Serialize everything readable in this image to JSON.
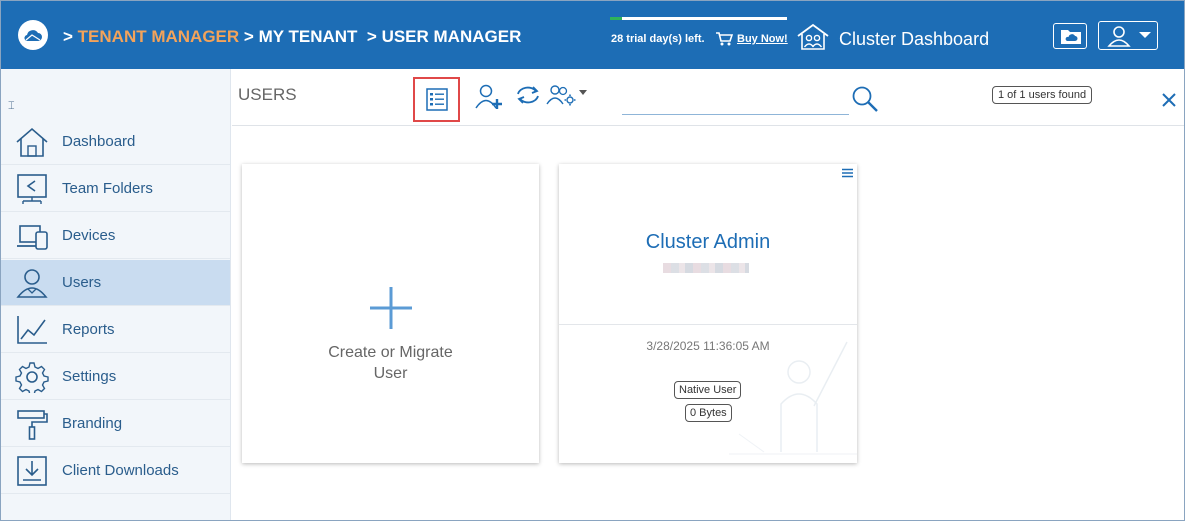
{
  "header": {
    "breadcrumb": {
      "sep1": ">",
      "tenant_manager": "TENANT MANAGER",
      "sep2": ">",
      "my_tenant": "MY TENANT",
      "sep3": ">",
      "user_manager": "USER MANAGER"
    },
    "trial_text": "28 trial day(s) left.",
    "trial_progress_fraction": 0.07,
    "buy_now": "Buy Now!",
    "cluster_dashboard": "Cluster Dashboard",
    "icons": [
      "cloud-logo-icon",
      "cart-icon",
      "home-users-icon",
      "folder-cloud-icon",
      "user-icon",
      "caret-down-icon"
    ]
  },
  "sidebar": {
    "items": [
      {
        "label": "Dashboard",
        "icon": "home-icon",
        "active": false
      },
      {
        "label": "Team Folders",
        "icon": "shared-folder-icon",
        "active": false
      },
      {
        "label": "Devices",
        "icon": "devices-icon",
        "active": false
      },
      {
        "label": "Users",
        "icon": "users-icon",
        "active": true
      },
      {
        "label": "Reports",
        "icon": "reports-icon",
        "active": false
      },
      {
        "label": "Settings",
        "icon": "gear-icon",
        "active": false
      },
      {
        "label": "Branding",
        "icon": "paint-roller-icon",
        "active": false
      },
      {
        "label": "Client Downloads",
        "icon": "download-icon",
        "active": false
      }
    ]
  },
  "toolbar": {
    "title": "USERS",
    "search": {
      "value": "",
      "placeholder": ""
    },
    "found": "1 of 1 users found"
  },
  "cards": {
    "create": {
      "line1": "Create or Migrate",
      "line2": "User"
    },
    "user": {
      "name": "Cluster Admin",
      "date": "3/28/2025 11:36:05 AM",
      "type": "Native User",
      "size": "0 Bytes"
    }
  },
  "colors": {
    "header_bg": "#1d6db5",
    "breadcrumb_accent": "#f3a35a",
    "active_nav_bg": "#c9dcf0",
    "highlight_border": "#e04848",
    "link_blue": "#1d6db5"
  }
}
